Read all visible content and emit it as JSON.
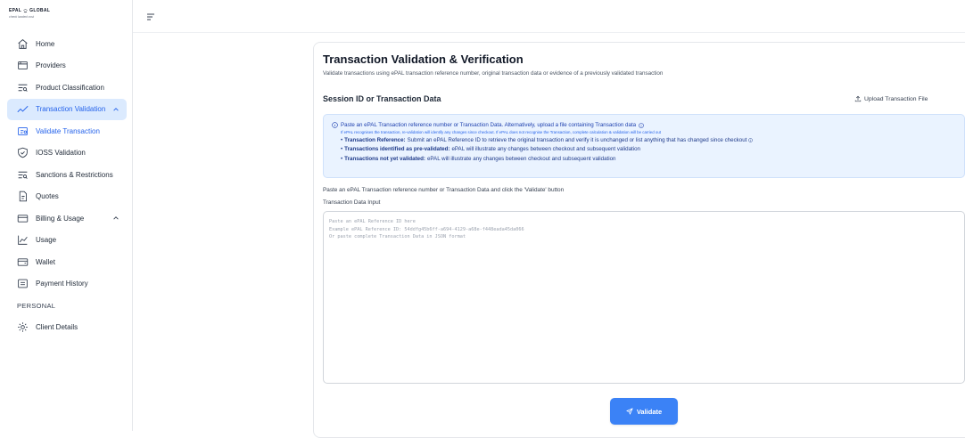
{
  "brand": {
    "name": "EPAL",
    "suffix": "GLOBAL",
    "tagline": "check landed cost"
  },
  "sidebar": {
    "items": [
      {
        "label": "Home",
        "icon": "home-icon"
      },
      {
        "label": "Providers",
        "icon": "providers-icon"
      },
      {
        "label": "Product Classification",
        "icon": "classification-icon"
      },
      {
        "label": "Transaction Validation",
        "icon": "validation-icon",
        "expanded": true
      },
      {
        "label": "Validate Transaction",
        "icon": "validate-icon"
      },
      {
        "label": "IOSS Validation",
        "icon": "shield-icon"
      },
      {
        "label": "Sanctions & Restrictions",
        "icon": "sanctions-icon"
      },
      {
        "label": "Quotes",
        "icon": "document-icon"
      },
      {
        "label": "Billing & Usage",
        "icon": "billing-icon",
        "expanded": true
      },
      {
        "label": "Usage",
        "icon": "chart-icon"
      },
      {
        "label": "Wallet",
        "icon": "wallet-icon"
      },
      {
        "label": "Payment History",
        "icon": "receipt-icon"
      }
    ],
    "section_personal": "PERSONAL",
    "client_details": "Client Details"
  },
  "main": {
    "title": "Transaction Validation & Verification",
    "subtitle": "Validate transactions using ePAL transaction reference number, original transaction data or evidence of a previously validated transaction",
    "section_title": "Session ID or Transaction Data",
    "upload_label": "Upload Transaction File",
    "info": {
      "line1": "Paste an ePAL Transaction reference number or Transaction Data. Alternatively, upload a file containing Transaction data",
      "line2": "If ePAL recognises the transaction, re-validation will identify any changes since checkout. If ePAL does not recognise the Transaction, complete calculation & validation will be carried out",
      "bullets": [
        {
          "bold": "Transaction Reference:",
          "text": " Submit an ePAL Reference ID to retrieve the original transaction and verify it is unchanged or list anything that has changed since checkout"
        },
        {
          "bold": "Transactions identified as pre-validated:",
          "text": " ePAL will illustrate any changes between checkout and subsequent validation"
        },
        {
          "bold": "Transactions not yet validated:",
          "text": " ePAL will illustrate any changes between checkout and subsequent validation"
        }
      ]
    },
    "paste_instruction": "Paste an ePAL Transaction reference number or Transaction Data and click the 'Validate' button",
    "input_label": "Transaction Data Input",
    "placeholder": {
      "line1": "Paste an ePAL Reference ID here",
      "line2": "Example ePAL Reference ID: 54ddfg45b6ff-a694-4129-a68e-f448eada45da066",
      "line3": "Or paste complete Transaction Data in JSON format"
    },
    "validate_label": "Validate"
  },
  "colors": {
    "accent": "#3b82f6",
    "active_bg": "#dbeafe",
    "info_bg": "#eaf3ff"
  }
}
